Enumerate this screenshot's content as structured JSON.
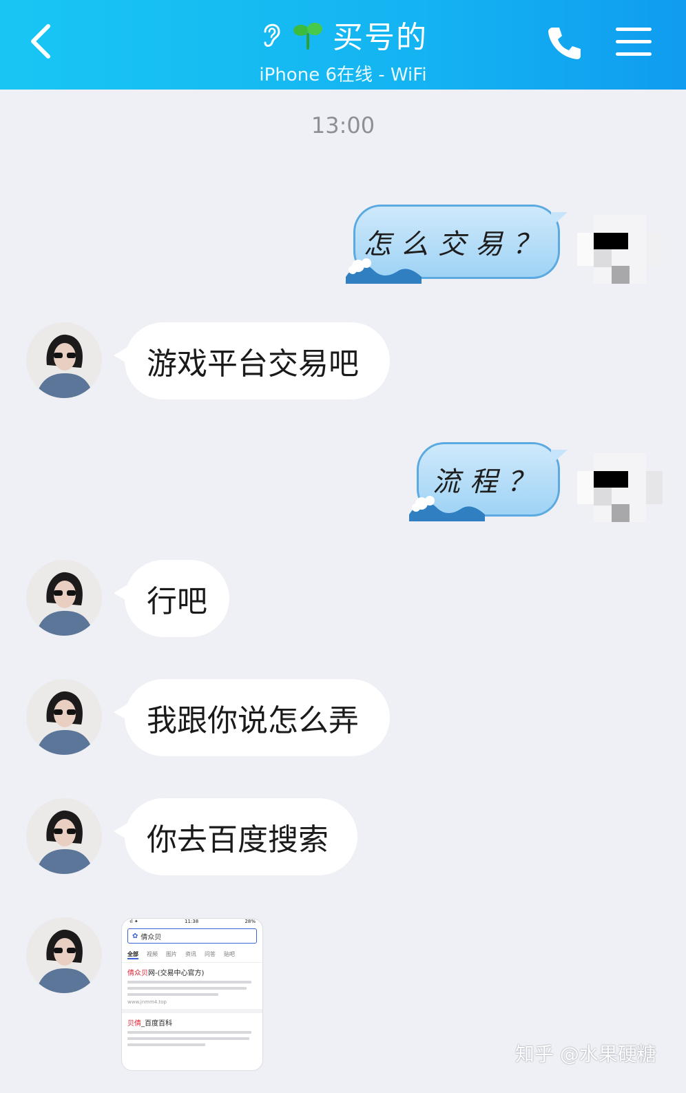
{
  "header": {
    "title": "买号的",
    "status": "iPhone 6在线 - WiFi",
    "icons": [
      "back-chevron-icon",
      "ear-icon",
      "sprout-icon",
      "phone-icon",
      "menu-icon"
    ],
    "accent": "#14b4f2"
  },
  "chat": {
    "timestamp": "13:00",
    "outgoing": [
      {
        "text": "怎么交易？"
      },
      {
        "text": "流程？"
      }
    ],
    "incoming": [
      {
        "text": "游戏平台交易吧"
      },
      {
        "text": "行吧"
      },
      {
        "text": "我跟你说怎么弄"
      },
      {
        "text": "你去百度搜索"
      }
    ],
    "image_message": {
      "status_time": "11:38",
      "status_batt": "28%",
      "status_signal": "ᐧıl ✦",
      "search_text": "倩众贝",
      "tabs": [
        "全部",
        "视频",
        "图片",
        "资讯",
        "问答",
        "贴吧"
      ],
      "result1_title_hl": "倩众贝",
      "result1_title_rest": "网-(交易中心官方)",
      "result1_url": "www.jnmm4.top",
      "result2_title_hl": "贝倩",
      "result2_title_rest": "_百度百科"
    }
  },
  "watermark": "知乎 @水果硬糖"
}
